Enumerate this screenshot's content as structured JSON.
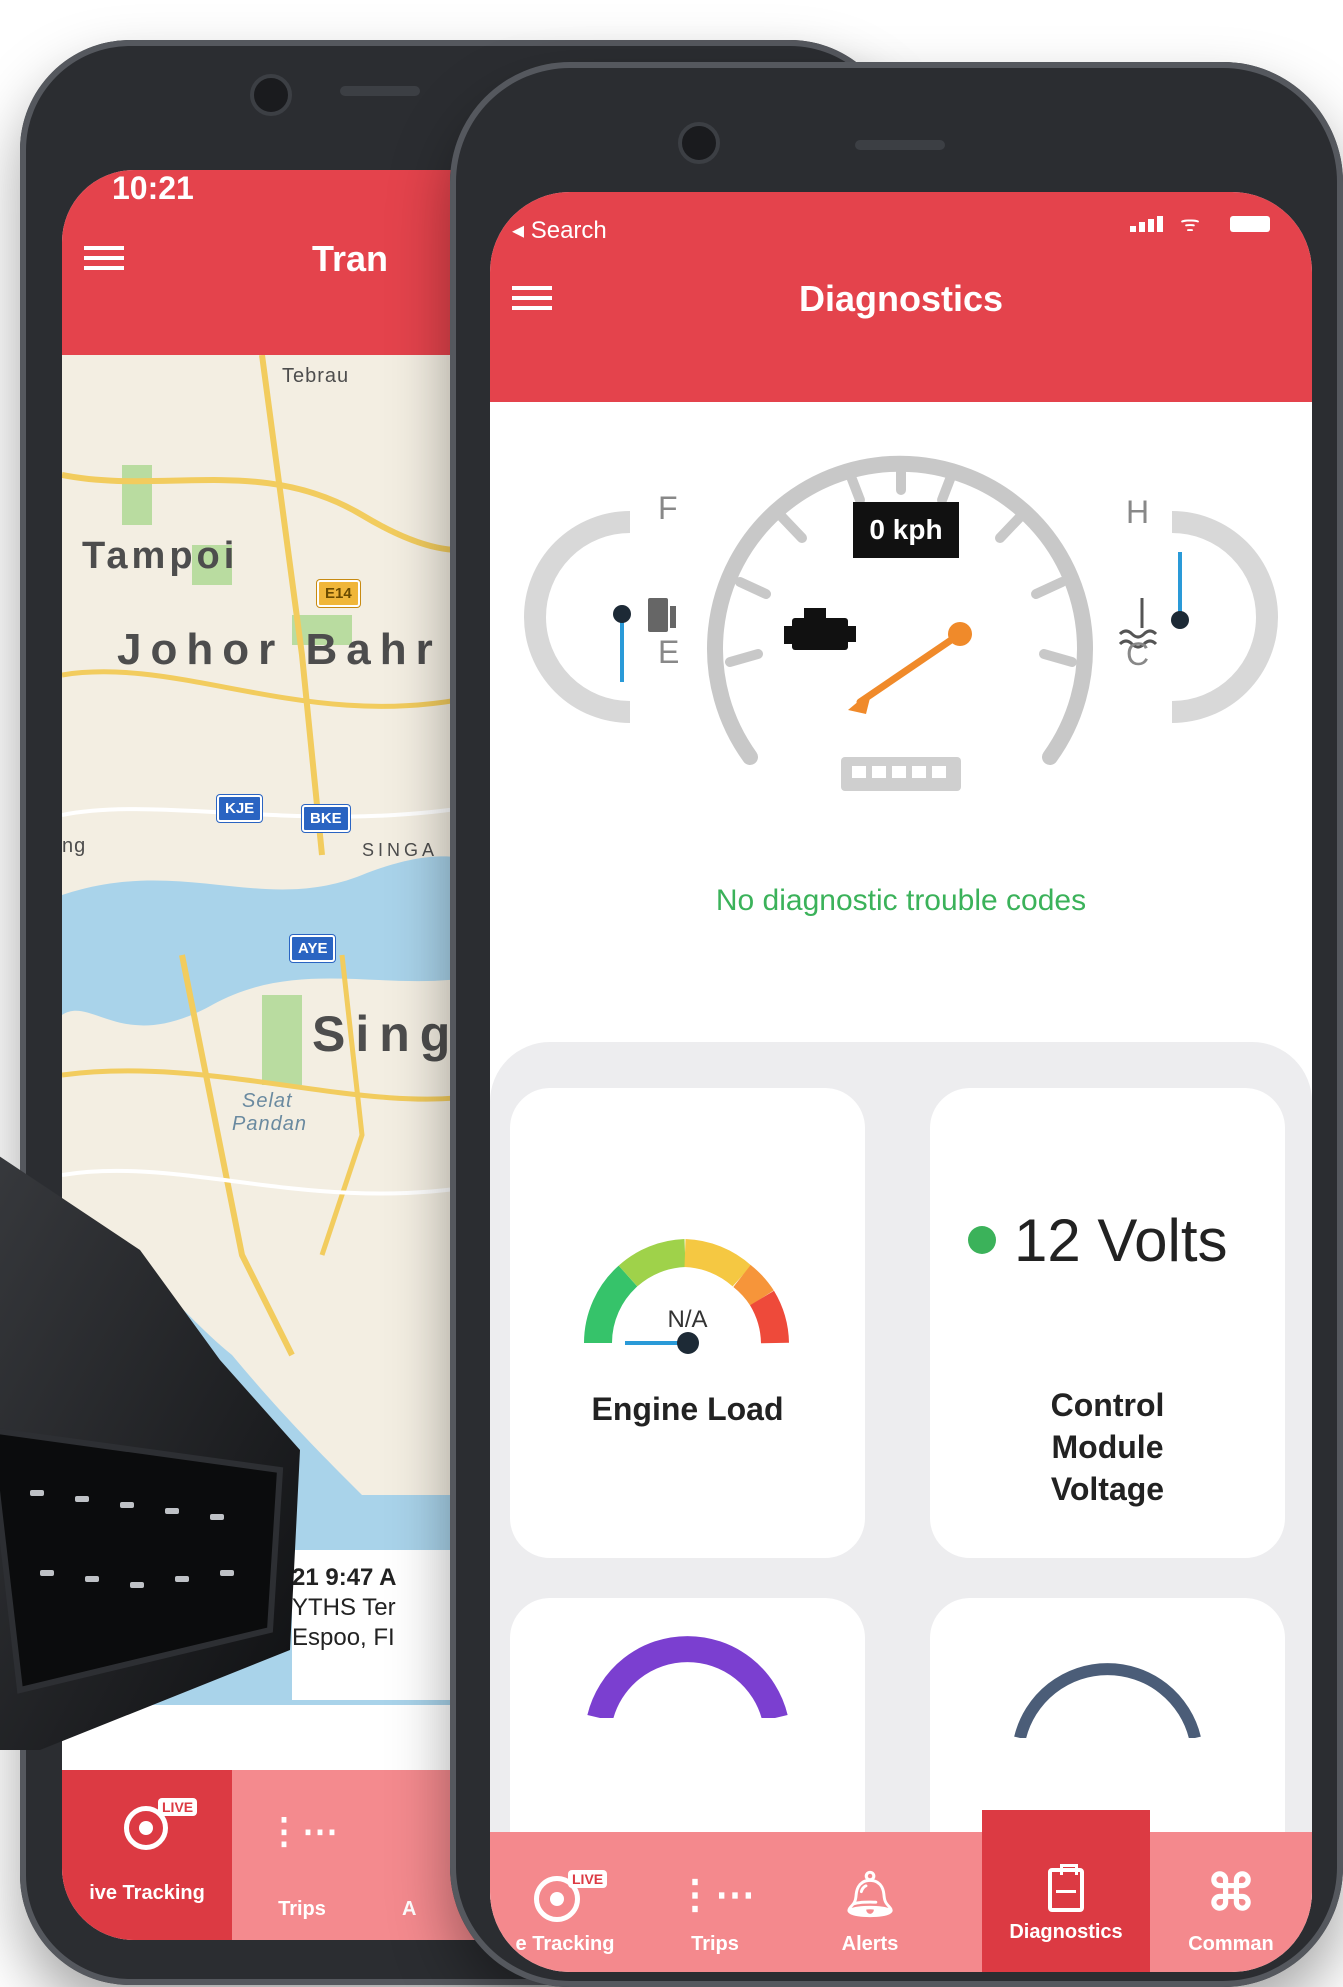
{
  "back_phone": {
    "status_time": "10:21",
    "header_title": "Tran",
    "map_labels": {
      "tebrau": "Tebrau",
      "tampoi": "Tampoi",
      "johor_bahru": "Johor Bahr",
      "singapore": "Sing",
      "selat_pandan_1": "Selat",
      "selat_pandan_2": "Pandan",
      "ng": "ng",
      "singa": "SINGA"
    },
    "road_shields": [
      "E14",
      "KJE",
      "BKE",
      "AYE"
    ],
    "trip_card": {
      "time": "21 9:47 A",
      "place": "YTHS Ter",
      "city": "Espoo, FI"
    },
    "tabs": [
      {
        "label": "ive Tracking",
        "icon": "live-tracking-icon",
        "badge": "LIVE"
      },
      {
        "label": "Trips",
        "icon": "trips-icon"
      },
      {
        "label": "A",
        "icon": "alerts-icon"
      }
    ]
  },
  "front_phone": {
    "status_back_label": "Search",
    "header_title": "Diagnostics",
    "gauge": {
      "speed": "0 kph",
      "fuel_full": "F",
      "fuel_empty": "E",
      "temp_hot": "H",
      "temp_cold": "C"
    },
    "dtc_message": "No diagnostic trouble codes",
    "cards": [
      {
        "title": "Engine Load",
        "value": "N/A"
      },
      {
        "title": "Control\nModule\nVoltage",
        "value": "12 Volts",
        "status_color": "#3bb25a"
      }
    ],
    "tabs": [
      {
        "label": "e Tracking",
        "icon": "live-tracking-icon",
        "badge": "LIVE",
        "active": false
      },
      {
        "label": "Trips",
        "icon": "trips-icon",
        "active": false
      },
      {
        "label": "Alerts",
        "icon": "bell-icon",
        "active": false
      },
      {
        "label": "Diagnostics",
        "icon": "clipboard-pulse-icon",
        "active": true
      },
      {
        "label": "Comman",
        "icon": "command-icon",
        "active": false
      }
    ]
  },
  "colors": {
    "brand_red": "#e4434c",
    "tabbar_pink": "#f4898d",
    "active_tab": "#dc3a43",
    "ok_green": "#3bb25a",
    "needle_orange": "#f08a2a",
    "gauge_grey": "#c8c8c8",
    "pointer_blue": "#2a9ad8"
  }
}
